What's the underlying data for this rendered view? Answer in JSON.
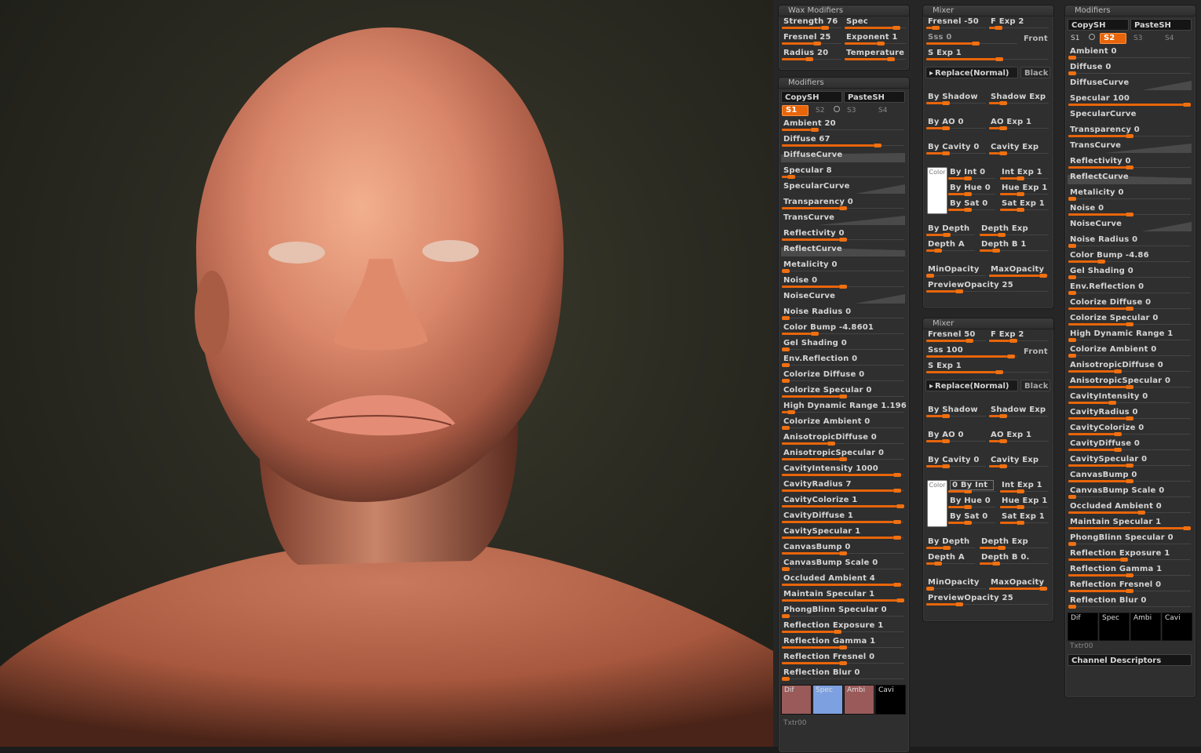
{
  "wax": {
    "title": "Wax Modifiers",
    "rows": [
      [
        {
          "label": "Strength 76",
          "v": 0.76
        },
        {
          "label": "Spec",
          "v": 0.9
        }
      ],
      [
        {
          "label": "Fresnel 25",
          "v": 0.6
        },
        {
          "label": "Exponent 1",
          "v": 0.6
        }
      ],
      [
        {
          "label": "Radius 20",
          "v": 0.45
        },
        {
          "label": "Temperature",
          "v": 0.8
        }
      ]
    ]
  },
  "mods1": {
    "title": "Modifiers",
    "copy": "CopySH",
    "paste": "PasteSH",
    "tabs": [
      "S1",
      "S2",
      "S3",
      "S4"
    ],
    "rows": [
      {
        "label": "Ambient 20",
        "v": 0.25
      },
      {
        "label": "Diffuse 67",
        "v": 0.8
      },
      {
        "label": "DiffuseCurve",
        "curve": true,
        "shape": "flat"
      },
      {
        "label": "Specular 8",
        "v": 0.05
      },
      {
        "label": "SpecularCurve",
        "curve": true,
        "shape": "ramp"
      },
      {
        "label": "Transparency 0",
        "v": 0.5
      },
      {
        "label": "TransCurve",
        "curve": true,
        "shape": "ramp2"
      },
      {
        "label": "Reflectivity 0",
        "v": 0.5
      },
      {
        "label": "ReflectCurve",
        "curve": true,
        "shape": "flat2"
      },
      {
        "label": "Metalicity 0",
        "v": 0.0
      },
      {
        "label": "Noise 0",
        "v": 0.5
      },
      {
        "label": "NoiseCurve",
        "curve": true,
        "shape": "ramp"
      },
      {
        "label": "Noise Radius 0",
        "v": 0.0
      },
      {
        "label": "Color Bump -4.8601",
        "v": 0.25
      },
      {
        "label": "Gel Shading 0",
        "v": 0.0
      },
      {
        "label": "Env.Reflection 0",
        "v": 0.0
      },
      {
        "label": "Colorize Diffuse 0",
        "v": 0.0
      },
      {
        "label": "Colorize Specular 0",
        "v": 0.5
      },
      {
        "label": "High Dynamic Range 1.196",
        "v": 0.05
      },
      {
        "label": "Colorize Ambient 0",
        "v": 0.0
      },
      {
        "label": "AnisotropicDiffuse 0",
        "v": 0.4
      },
      {
        "label": "AnisotropicSpecular 0",
        "v": 0.5
      },
      {
        "label": "CavityIntensity 1000",
        "v": 0.97
      },
      {
        "label": "CavityRadius 7",
        "v": 0.97
      },
      {
        "label": "CavityColorize 1",
        "v": 1.0
      },
      {
        "label": "CavityDiffuse 1",
        "v": 0.97
      },
      {
        "label": "CavitySpecular 1",
        "v": 0.97
      },
      {
        "label": "CanvasBump 0",
        "v": 0.5
      },
      {
        "label": "CanvasBump Scale 0",
        "v": 0.0
      },
      {
        "label": "Occluded Ambient 4",
        "v": 0.97
      },
      {
        "label": "Maintain Specular 1",
        "v": 1.0
      },
      {
        "label": "PhongBlinn Specular 0",
        "v": 0.0
      },
      {
        "label": "Reflection Exposure 1",
        "v": 0.45
      },
      {
        "label": "Reflection Gamma 1",
        "v": 0.5
      },
      {
        "label": "Reflection Fresnel 0",
        "v": 0.5
      },
      {
        "label": "Reflection Blur 0",
        "v": 0.0
      }
    ],
    "thumbs": [
      {
        "label": "Dif",
        "color": "#9a5a5a"
      },
      {
        "label": "Spec",
        "color": "#7da0e0"
      },
      {
        "label": "Ambi",
        "color": "#9a5a5a"
      },
      {
        "label": "Cavi",
        "color": "#000000"
      }
    ],
    "txtr": "Txtr00"
  },
  "mixer1": {
    "title": "Mixer",
    "top": [
      [
        {
          "label": "Fresnel -50",
          "v": 0.1
        },
        {
          "label": "F Exp 2",
          "v": 0.1
        }
      ],
      [
        {
          "label": "Sss 0",
          "v": 0.55,
          "dim": true
        },
        {
          "btn": "Front"
        }
      ],
      [
        {
          "label": "S Exp 1",
          "v": 0.6,
          "full": true
        }
      ]
    ],
    "replace": "Replace(Normal)",
    "black": "Black",
    "pairs": [
      [
        {
          "label": "By Shadow",
          "v": 0.3
        },
        {
          "label": "Shadow Exp",
          "v": 0.2
        }
      ],
      [
        {
          "label": "By AO 0",
          "v": 0.3
        },
        {
          "label": "AO Exp 1",
          "v": 0.2
        }
      ],
      [
        {
          "label": "By Cavity 0",
          "v": 0.3
        },
        {
          "label": "Cavity Exp",
          "v": 0.2
        }
      ]
    ],
    "color_label": "Color",
    "colorrows": [
      [
        {
          "label": "By Int 0",
          "v": 0.4
        },
        {
          "label": "Int Exp 1",
          "v": 0.4
        }
      ],
      [
        {
          "label": "By Hue 0",
          "v": 0.4
        },
        {
          "label": "Hue Exp 1",
          "v": 0.4
        }
      ],
      [
        {
          "label": "By Sat 0",
          "v": 0.4
        },
        {
          "label": "Sat Exp 1",
          "v": 0.4
        }
      ]
    ],
    "depth": [
      [
        {
          "label": "By Depth",
          "v": 0.4
        },
        {
          "label": "Depth Exp",
          "v": 0.3
        }
      ],
      [
        {
          "label": "Depth A",
          "v": 0.2
        },
        {
          "label": "Depth B 1",
          "v": 0.2
        }
      ]
    ],
    "opacity": [
      {
        "label": "MinOpacity",
        "v": 0.0
      },
      {
        "label": "MaxOpacity",
        "v": 0.97
      }
    ],
    "preview": {
      "label": "PreviewOpacity 25",
      "v": 0.25
    }
  },
  "mixer2": {
    "title": "Mixer",
    "top": [
      [
        {
          "label": "Fresnel 50",
          "v": 0.75
        },
        {
          "label": "F Exp 2",
          "v": 0.4
        }
      ],
      [
        {
          "label": "Sss 100",
          "v": 0.97
        },
        {
          "btn": "Front"
        }
      ],
      [
        {
          "label": "S Exp 1",
          "v": 0.6,
          "full": true
        }
      ]
    ],
    "replace": "Replace(Normal)",
    "black": "Black",
    "pairs": [
      [
        {
          "label": "By Shadow",
          "v": 0.3
        },
        {
          "label": "Shadow Exp",
          "v": 0.2
        }
      ],
      [
        {
          "label": "By AO 0",
          "v": 0.3
        },
        {
          "label": "AO Exp 1",
          "v": 0.2
        }
      ],
      [
        {
          "label": "By Cavity 0",
          "v": 0.3
        },
        {
          "label": "Cavity Exp",
          "v": 0.2
        }
      ]
    ],
    "color_label": "Color",
    "colorrows": [
      [
        {
          "label": "0 By Int",
          "v": 0.4,
          "boxed": true
        },
        {
          "label": "Int Exp 1",
          "v": 0.4
        }
      ],
      [
        {
          "label": "By Hue 0",
          "v": 0.4
        },
        {
          "label": "Hue Exp 1",
          "v": 0.4
        }
      ],
      [
        {
          "label": "By Sat 0",
          "v": 0.4
        },
        {
          "label": "Sat Exp 1",
          "v": 0.4
        }
      ]
    ],
    "depth": [
      [
        {
          "label": "By Depth",
          "v": 0.4
        },
        {
          "label": "Depth Exp",
          "v": 0.3
        }
      ],
      [
        {
          "label": "Depth A",
          "v": 0.2
        },
        {
          "label": "Depth B 0.",
          "v": 0.2
        }
      ]
    ],
    "opacity": [
      {
        "label": "MinOpacity",
        "v": 0.0
      },
      {
        "label": "MaxOpacity",
        "v": 0.97
      }
    ],
    "preview": {
      "label": "PreviewOpacity 25",
      "v": 0.25
    }
  },
  "mods2": {
    "title": "Modifiers",
    "copy": "CopySH",
    "paste": "PasteSH",
    "tabs": [
      "S1",
      "S2",
      "S3",
      "S4"
    ],
    "rows": [
      {
        "label": "Ambient 0",
        "v": 0.0
      },
      {
        "label": "Diffuse 0",
        "v": 0.0
      },
      {
        "label": "DiffuseCurve",
        "curve": true,
        "shape": "ramp"
      },
      {
        "label": "Specular 100",
        "v": 1.0
      },
      {
        "label": "SpecularCurve",
        "curve": true,
        "shape": "none"
      },
      {
        "label": "Transparency 0",
        "v": 0.5
      },
      {
        "label": "TransCurve",
        "curve": true,
        "shape": "ramp2"
      },
      {
        "label": "Reflectivity 0",
        "v": 0.5
      },
      {
        "label": "ReflectCurve",
        "curve": true,
        "shape": "flat2"
      },
      {
        "label": "Metalicity 0",
        "v": 0.0
      },
      {
        "label": "Noise 0",
        "v": 0.5
      },
      {
        "label": "NoiseCurve",
        "curve": true,
        "shape": "ramp"
      },
      {
        "label": "Noise Radius 0",
        "v": 0.0
      },
      {
        "label": "Color Bump -4.86",
        "v": 0.25
      },
      {
        "label": "Gel Shading 0",
        "v": 0.0
      },
      {
        "label": "Env.Reflection 0",
        "v": 0.0
      },
      {
        "label": "Colorize Diffuse 0",
        "v": 0.5
      },
      {
        "label": "Colorize Specular 0",
        "v": 0.5
      },
      {
        "label": "High Dynamic Range 1",
        "v": 0.0
      },
      {
        "label": "Colorize Ambient 0",
        "v": 0.0
      },
      {
        "label": "AnisotropicDiffuse 0",
        "v": 0.4
      },
      {
        "label": "AnisotropicSpecular 0",
        "v": 0.5
      },
      {
        "label": "CavityIntensity 0",
        "v": 0.35
      },
      {
        "label": "CavityRadius 0",
        "v": 0.5
      },
      {
        "label": "CavityColorize 0",
        "v": 0.4
      },
      {
        "label": "CavityDiffuse 0",
        "v": 0.4
      },
      {
        "label": "CavitySpecular 0",
        "v": 0.5
      },
      {
        "label": "CanvasBump 0",
        "v": 0.5
      },
      {
        "label": "CanvasBump Scale 0",
        "v": 0.0
      },
      {
        "label": "Occluded Ambient 0",
        "v": 0.6
      },
      {
        "label": "Maintain Specular 1",
        "v": 1.0
      },
      {
        "label": "PhongBlinn Specular 0",
        "v": 0.0
      },
      {
        "label": "Reflection Exposure 1",
        "v": 0.45
      },
      {
        "label": "Reflection Gamma 1",
        "v": 0.5
      },
      {
        "label": "Reflection Fresnel 0",
        "v": 0.5
      },
      {
        "label": "Reflection Blur 0",
        "v": 0.0
      }
    ],
    "thumbs": [
      {
        "label": "Dif",
        "color": "#000000"
      },
      {
        "label": "Spec",
        "color": "#000000"
      },
      {
        "label": "Ambi",
        "color": "#000000"
      },
      {
        "label": "Cavi",
        "color": "#000000"
      }
    ],
    "txtr": "Txtr00",
    "channel": "Channel Descriptors"
  },
  "colors": {
    "accent": "#e8650a",
    "panel": "#2f2f2f"
  }
}
